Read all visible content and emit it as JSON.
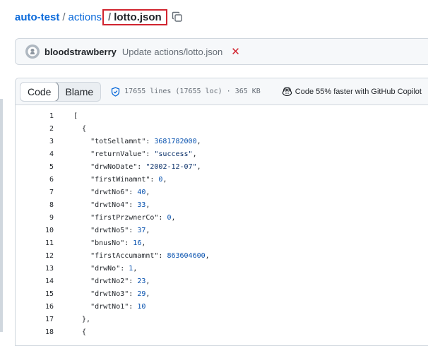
{
  "breadcrumb": {
    "repo": "auto-test",
    "folder": "actions",
    "separator": "/",
    "file": "lotto.json"
  },
  "commit": {
    "author": "bloodstrawberry",
    "message": "Update actions/lotto.json",
    "status": "✕"
  },
  "file_header": {
    "tabs": [
      "Code",
      "Blame"
    ],
    "active_tab": "Code",
    "lines_info": "17655 lines (17655 loc)",
    "size": "365 KB",
    "copilot_text": "Code 55% faster with GitHub Copilot"
  },
  "code_lines": [
    {
      "n": "1",
      "text": "["
    },
    {
      "n": "2",
      "text": "  {"
    },
    {
      "n": "3",
      "text": "    \"totSellamnt\": 3681782000,"
    },
    {
      "n": "4",
      "text": "    \"returnValue\": \"success\","
    },
    {
      "n": "5",
      "text": "    \"drwNoDate\": \"2002-12-07\","
    },
    {
      "n": "6",
      "text": "    \"firstWinamnt\": 0,"
    },
    {
      "n": "7",
      "text": "    \"drwtNo6\": 40,"
    },
    {
      "n": "8",
      "text": "    \"drwtNo4\": 33,"
    },
    {
      "n": "9",
      "text": "    \"firstPrzwnerCo\": 0,"
    },
    {
      "n": "10",
      "text": "    \"drwtNo5\": 37,"
    },
    {
      "n": "11",
      "text": "    \"bnusNo\": 16,"
    },
    {
      "n": "12",
      "text": "    \"firstAccumamnt\": 863604600,"
    },
    {
      "n": "13",
      "text": "    \"drwNo\": 1,"
    },
    {
      "n": "14",
      "text": "    \"drwtNo2\": 23,"
    },
    {
      "n": "15",
      "text": "    \"drwtNo3\": 29,"
    },
    {
      "n": "16",
      "text": "    \"drwtNo1\": 10"
    },
    {
      "n": "17",
      "text": "  },"
    },
    {
      "n": "18",
      "text": "  {"
    }
  ],
  "icons": {
    "copy": "copy-icon",
    "avatar": "github-avatar-icon",
    "shield": "shield-check-icon",
    "copilot": "copilot-icon"
  },
  "colors": {
    "link": "#0969da",
    "highlight_border": "#d1242f",
    "string": "#0a3069",
    "number": "#0550ae"
  }
}
